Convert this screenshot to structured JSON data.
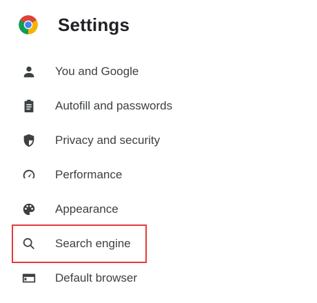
{
  "header": {
    "logo_icon": "chrome-logo-icon",
    "title": "Settings"
  },
  "sidebar": {
    "items": [
      {
        "label": "You and Google",
        "icon": "person-icon"
      },
      {
        "label": "Autofill and passwords",
        "icon": "clipboard-icon"
      },
      {
        "label": "Privacy and security",
        "icon": "shield-icon"
      },
      {
        "label": "Performance",
        "icon": "speedometer-icon"
      },
      {
        "label": "Appearance",
        "icon": "palette-icon"
      },
      {
        "label": "Search engine",
        "icon": "search-icon",
        "highlighted": true
      },
      {
        "label": "Default browser",
        "icon": "browser-window-icon"
      }
    ]
  },
  "colors": {
    "highlight_border": "#e53935",
    "text": "#3c4043",
    "title": "#202124"
  }
}
